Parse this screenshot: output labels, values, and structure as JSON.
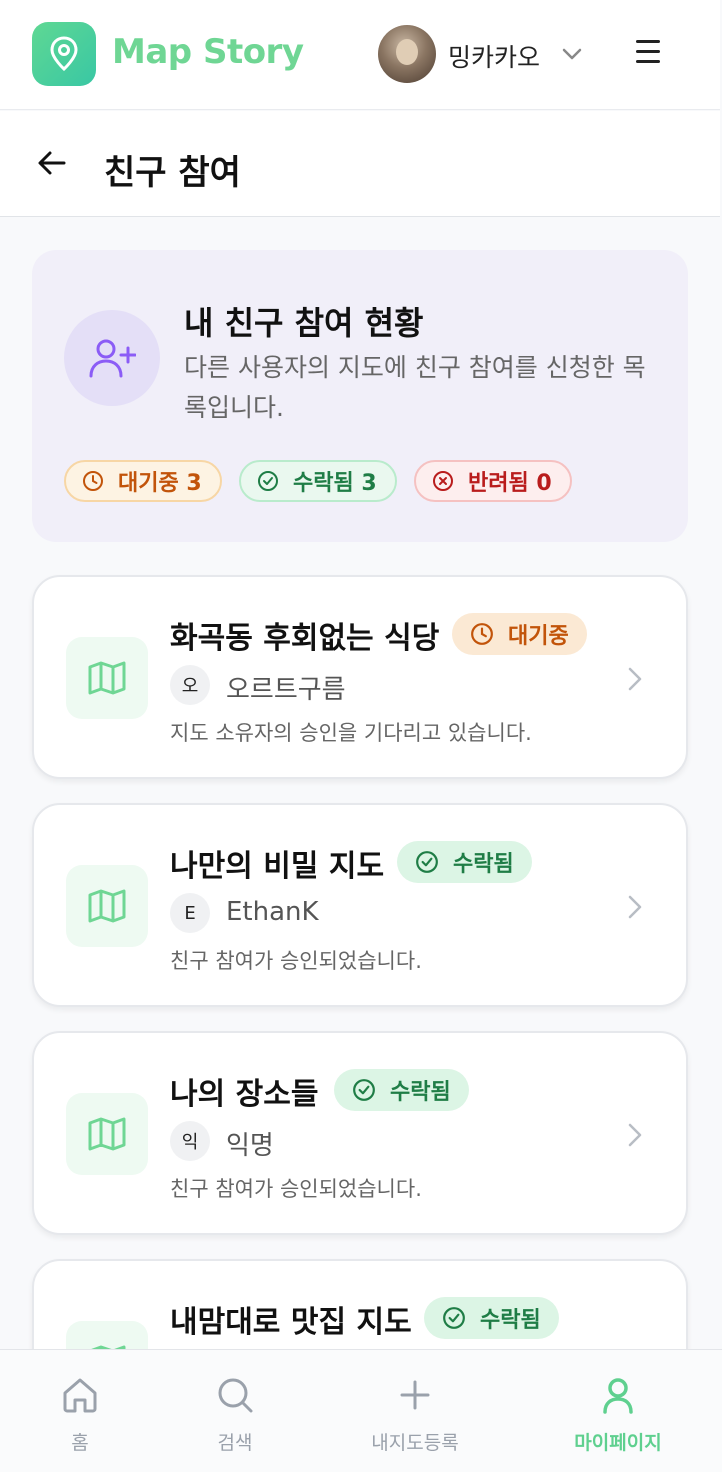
{
  "header": {
    "logo_text": "Map Story",
    "user_name": "밍카카오"
  },
  "page": {
    "title": "친구 참여"
  },
  "summary": {
    "title": "내 친구 참여 현황",
    "description": "다른 사용자의 지도에 친구 참여를 신청한 목록입니다.",
    "pills": {
      "pending": "대기중 3",
      "accepted": "수락됨 3",
      "rejected": "반려됨 0"
    }
  },
  "cards": [
    {
      "title": "화곡동 후회없는 식당",
      "status": "대기중",
      "owner_initial": "오",
      "owner_name": "오르트구름",
      "message": "지도 소유자의 승인을 기다리고 있습니다."
    },
    {
      "title": "나만의 비밀 지도",
      "status": "수락됨",
      "owner_initial": "E",
      "owner_name": "EthanK",
      "message": "친구 참여가 승인되었습니다."
    },
    {
      "title": "나의 장소들",
      "status": "수락됨",
      "owner_initial": "익",
      "owner_name": "익명",
      "message": "친구 참여가 승인되었습니다."
    },
    {
      "title": "내맘대로 맛집 지도",
      "status": "수락됨"
    }
  ],
  "bottom_nav": {
    "home": "홈",
    "search": "검색",
    "register": "내지도등록",
    "mypage": "마이페이지"
  },
  "colors": {
    "brand_green": "#6fd694",
    "pending_orange": "#c2540a",
    "accepted_green": "#1f7d46",
    "rejected_red": "#b91c1c",
    "summary_bg": "#f1eff9"
  },
  "icons": [
    "map-pin-icon",
    "chevron-down-icon",
    "menu-icon",
    "back-arrow-icon",
    "user-plus-icon",
    "clock-icon",
    "check-circle-icon",
    "x-circle-icon",
    "map-icon",
    "chevron-right-icon",
    "home-icon",
    "search-icon",
    "plus-icon",
    "user-icon"
  ]
}
